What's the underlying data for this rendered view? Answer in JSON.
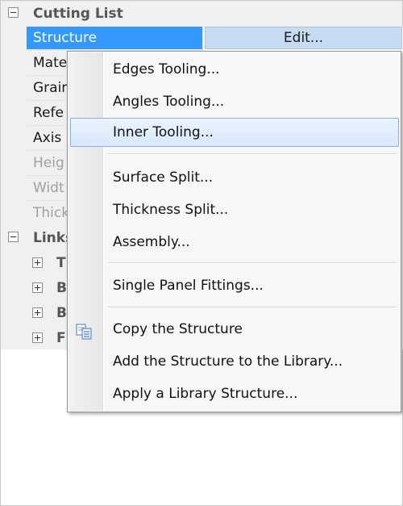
{
  "property_grid": {
    "category_cutting_list": "Cutting List",
    "rows": [
      {
        "label": "Structure",
        "state": "selected"
      },
      {
        "label": "Mate",
        "state": "normal"
      },
      {
        "label": "Grair",
        "state": "normal"
      },
      {
        "label": "Refe",
        "state": "normal"
      },
      {
        "label": "Axis",
        "state": "normal"
      },
      {
        "label": "Heig",
        "state": "disabled"
      },
      {
        "label": "Widt",
        "state": "disabled"
      },
      {
        "label": "Thick",
        "state": "disabled"
      }
    ],
    "category_links": "Links",
    "sub_categories": [
      "T",
      "B",
      "B",
      "F"
    ],
    "edit_button_label": "Edit..."
  },
  "context_menu": {
    "items": [
      {
        "label": "Edges Tooling...",
        "mnemonic": "E"
      },
      {
        "label": "Angles Tooling...",
        "mnemonic": "A"
      },
      {
        "label": "Inner Tooling...",
        "mnemonic": "I",
        "highlighted": true
      },
      {
        "label": "Surface Split...",
        "mnemonic": "S"
      },
      {
        "label": "Thickness Split...",
        "mnemonic": "T"
      },
      {
        "label": "Assembly...",
        "mnemonic": "m"
      },
      {
        "label": "Single Panel Fittings...",
        "mnemonic": "F"
      },
      {
        "label": "Copy the Structure",
        "mnemonic": "S",
        "icon": "copy-icon"
      },
      {
        "label": "Add the Structure to the Library...",
        "mnemonic": "L"
      },
      {
        "label": "Apply a Library Structure...",
        "mnemonic": "A"
      }
    ]
  },
  "colors": {
    "selection": "#3399ff",
    "menu_highlight_border": "#7fb2e6",
    "edit_button_bg": "#c6dcf2"
  }
}
